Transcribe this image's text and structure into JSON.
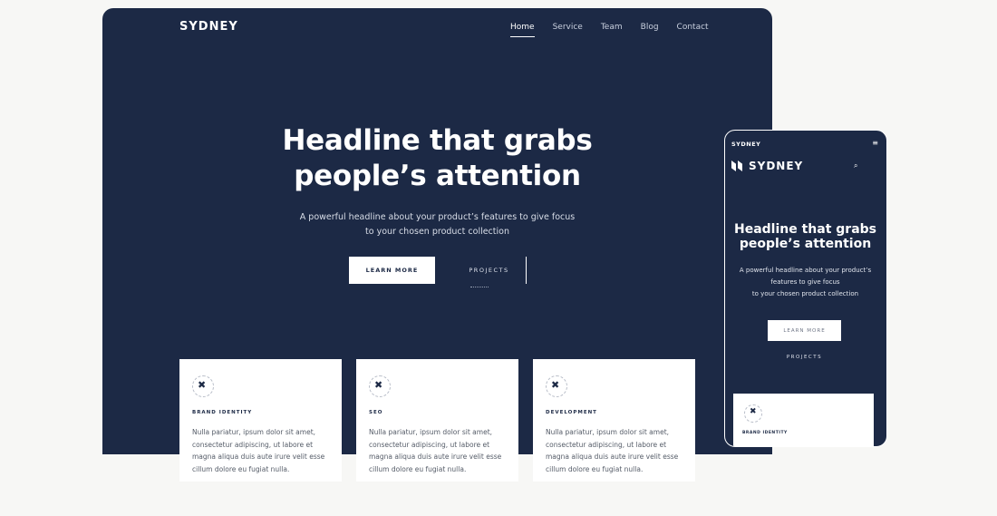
{
  "desktop": {
    "logo": "SYDNEY",
    "nav": [
      "Home",
      "Service",
      "Team",
      "Blog",
      "Contact"
    ],
    "active_nav": "Home",
    "headline_line1": "Headline that grabs",
    "headline_line2": "people’s attention",
    "sub_line1": "A powerful headline about your product’s features to give focus",
    "sub_line2": "to your chosen product collection",
    "learn_more": "LEARN MORE",
    "projects": "PROJECTS",
    "cards": [
      {
        "title": "BRAND IDENTITY",
        "text": "Nulla pariatur, ipsum dolor sit amet, consectetur adipiscing, ut labore et magna aliqua duis aute irure velit esse cillum dolore eu fugiat nulla."
      },
      {
        "title": "SEO",
        "text": "Nulla pariatur, ipsum dolor sit amet, consectetur adipiscing, ut labore et magna aliqua duis aute irure velit esse cillum dolore eu fugiat nulla."
      },
      {
        "title": "DEVELOPMENT",
        "text": "Nulla pariatur, ipsum dolor sit amet, consectetur adipiscing, ut labore et magna aliqua duis aute irure velit esse cillum dolore eu fugiat nulla."
      }
    ]
  },
  "mobile": {
    "top_label": "SYDNEY",
    "brand": "SYDNEY",
    "headline_line1": "Headline that grabs",
    "headline_line2": "people’s attention",
    "sub_line1": "A powerful headline about your product’s",
    "sub_line2": "features to give focus",
    "sub_line3": "to your chosen product collection",
    "learn_more": "LEARN MORE",
    "projects": "PROJECTS",
    "card_title": "BRAND IDENTITY"
  },
  "icons": {
    "card_icon": "cross-icon",
    "mobile_menu": "menu-icon",
    "mobile_search": "search-icon",
    "brand_mark": "logo-icon"
  },
  "colors": {
    "navy": "#1c2945",
    "background": "#f7f7f5",
    "card": "#ffffff"
  }
}
